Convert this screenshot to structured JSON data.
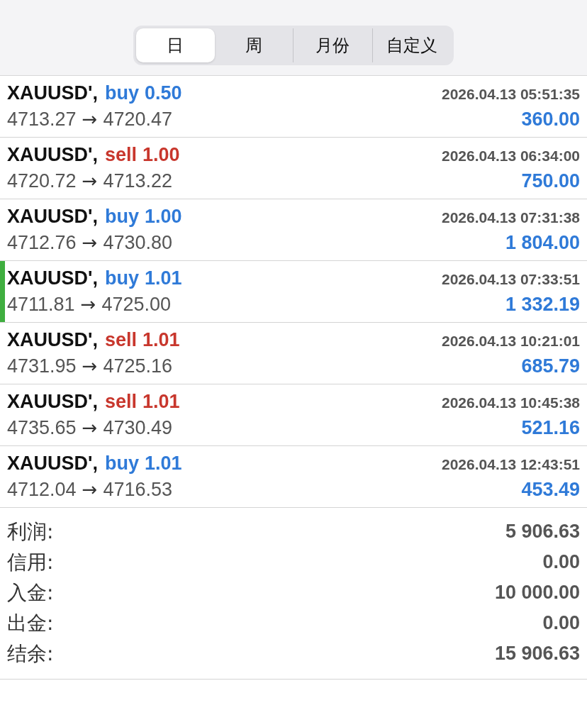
{
  "period_tabs": [
    {
      "label": "日",
      "selected": true
    },
    {
      "label": "周",
      "selected": false
    },
    {
      "label": "月份",
      "selected": false
    },
    {
      "label": "自定义",
      "selected": false
    }
  ],
  "deals": [
    {
      "symbol": "XAUUSD',",
      "kind": "buy",
      "side": "buy",
      "volume": "0.50",
      "time": "2026.04.13 05:51:35",
      "open_price": "4713.27",
      "arrow": "→",
      "close_price": "4720.47",
      "profit": "360.00",
      "marked": false
    },
    {
      "symbol": "XAUUSD',",
      "kind": "sell",
      "side": "sell",
      "volume": "1.00",
      "time": "2026.04.13 06:34:00",
      "open_price": "4720.72",
      "arrow": "→",
      "close_price": "4713.22",
      "profit": "750.00",
      "marked": false
    },
    {
      "symbol": "XAUUSD',",
      "kind": "buy",
      "side": "buy",
      "volume": "1.00",
      "time": "2026.04.13 07:31:38",
      "open_price": "4712.76",
      "arrow": "→",
      "close_price": "4730.80",
      "profit": "1 804.00",
      "marked": false
    },
    {
      "symbol": "XAUUSD',",
      "kind": "buy",
      "side": "buy",
      "volume": "1.01",
      "time": "2026.04.13 07:33:51",
      "open_price": "4711.81",
      "arrow": "→",
      "close_price": "4725.00",
      "profit": "1 332.19",
      "marked": true
    },
    {
      "symbol": "XAUUSD',",
      "kind": "sell",
      "side": "sell",
      "volume": "1.01",
      "time": "2026.04.13 10:21:01",
      "open_price": "4731.95",
      "arrow": "→",
      "close_price": "4725.16",
      "profit": "685.79",
      "marked": false
    },
    {
      "symbol": "XAUUSD',",
      "kind": "sell",
      "side": "sell",
      "volume": "1.01",
      "time": "2026.04.13 10:45:38",
      "open_price": "4735.65",
      "arrow": "→",
      "close_price": "4730.49",
      "profit": "521.16",
      "marked": false
    },
    {
      "symbol": "XAUUSD',",
      "kind": "buy",
      "side": "buy",
      "volume": "1.01",
      "time": "2026.04.13 12:43:51",
      "open_price": "4712.04",
      "arrow": "→",
      "close_price": "4716.53",
      "profit": "453.49",
      "marked": false
    }
  ],
  "summary": [
    {
      "label": "利润:",
      "value": "5 906.63"
    },
    {
      "label": "信用:",
      "value": "0.00"
    },
    {
      "label": "入金:",
      "value": "10 000.00"
    },
    {
      "label": "出金:",
      "value": "0.00"
    },
    {
      "label": "结余:",
      "value": "15 906.63"
    }
  ]
}
